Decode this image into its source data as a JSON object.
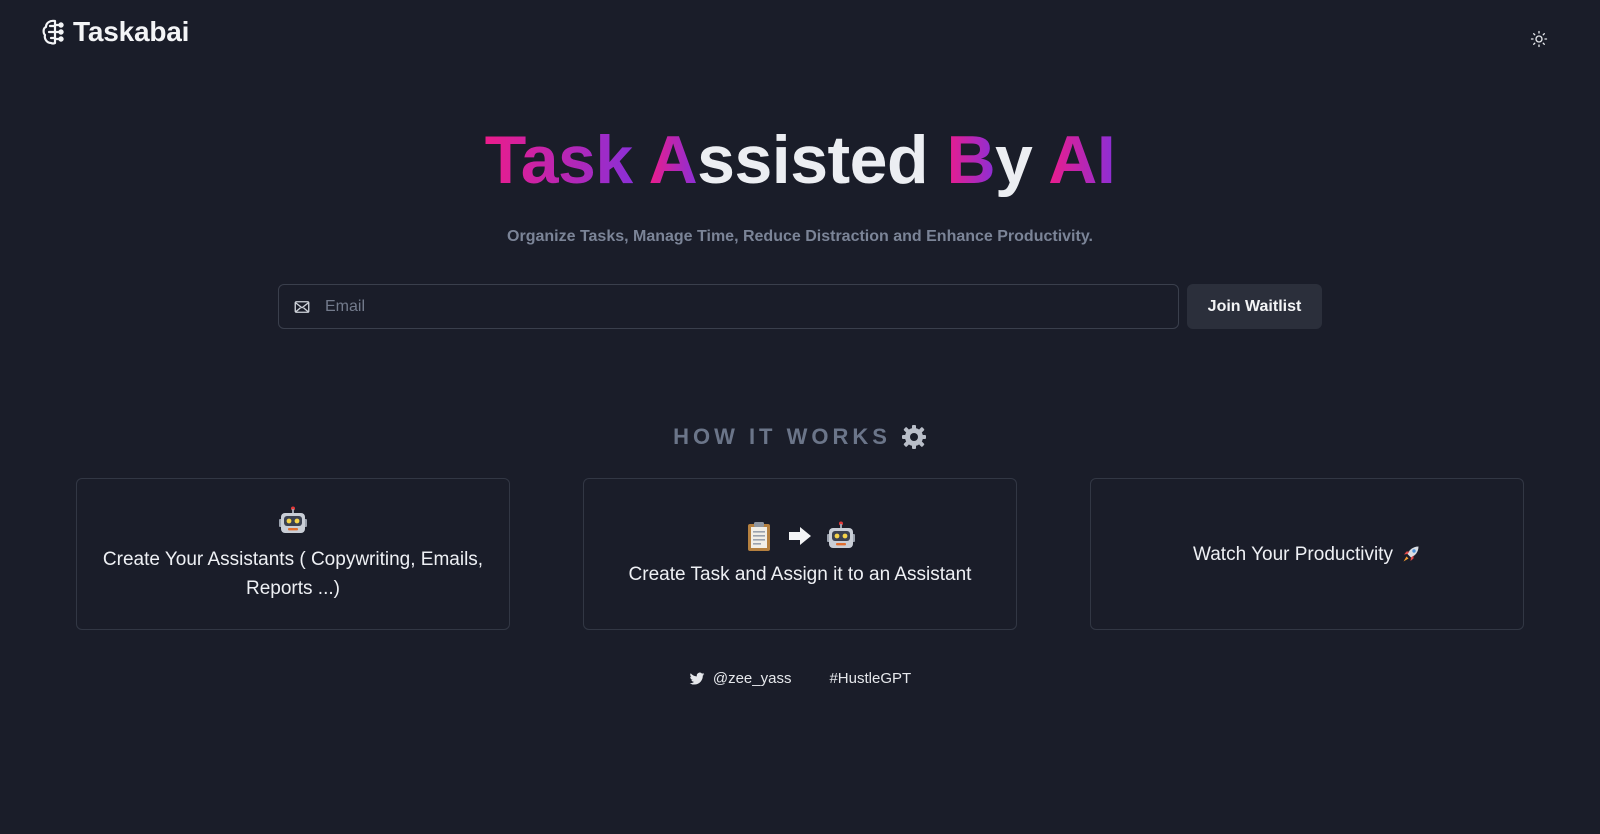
{
  "header": {
    "logo_text": "Taskabai",
    "logo_icon": "brain-circuit-icon",
    "theme_toggle_icon": "sun-icon"
  },
  "hero": {
    "title_words": [
      "Task",
      "A",
      "ssisted",
      "B",
      "y",
      "AI"
    ],
    "subtitle": "Organize Tasks, Manage Time, Reduce Distraction and Enhance Productivity."
  },
  "waitlist": {
    "email_placeholder": "Email",
    "email_value": "",
    "mail_icon": "mail-icon",
    "join_label": "Join Waitlist"
  },
  "how_it_works": {
    "title": "HOW IT WORKS",
    "title_icon": "gear-icon",
    "cards": [
      {
        "icons": [
          "robot-icon"
        ],
        "text": "Create Your Assistants ( Copywriting, Emails, Reports ...)"
      },
      {
        "icons": [
          "clipboard-icon",
          "arrow-right-icon",
          "robot-icon"
        ],
        "text": "Create Task and Assign it to an Assistant"
      },
      {
        "icons": [
          "rocket-icon"
        ],
        "text": "Watch Your Productivity"
      }
    ]
  },
  "footer": {
    "twitter_handle": "@zee_yass",
    "twitter_icon": "twitter-icon",
    "hashtag": "#HustleGPT"
  },
  "colors": {
    "background": "#1a1d29",
    "gradient_start": "#ec1c8b",
    "gradient_end": "#8b2fd6",
    "muted_text": "#7b8497",
    "button_bg": "#2b2f3b"
  }
}
